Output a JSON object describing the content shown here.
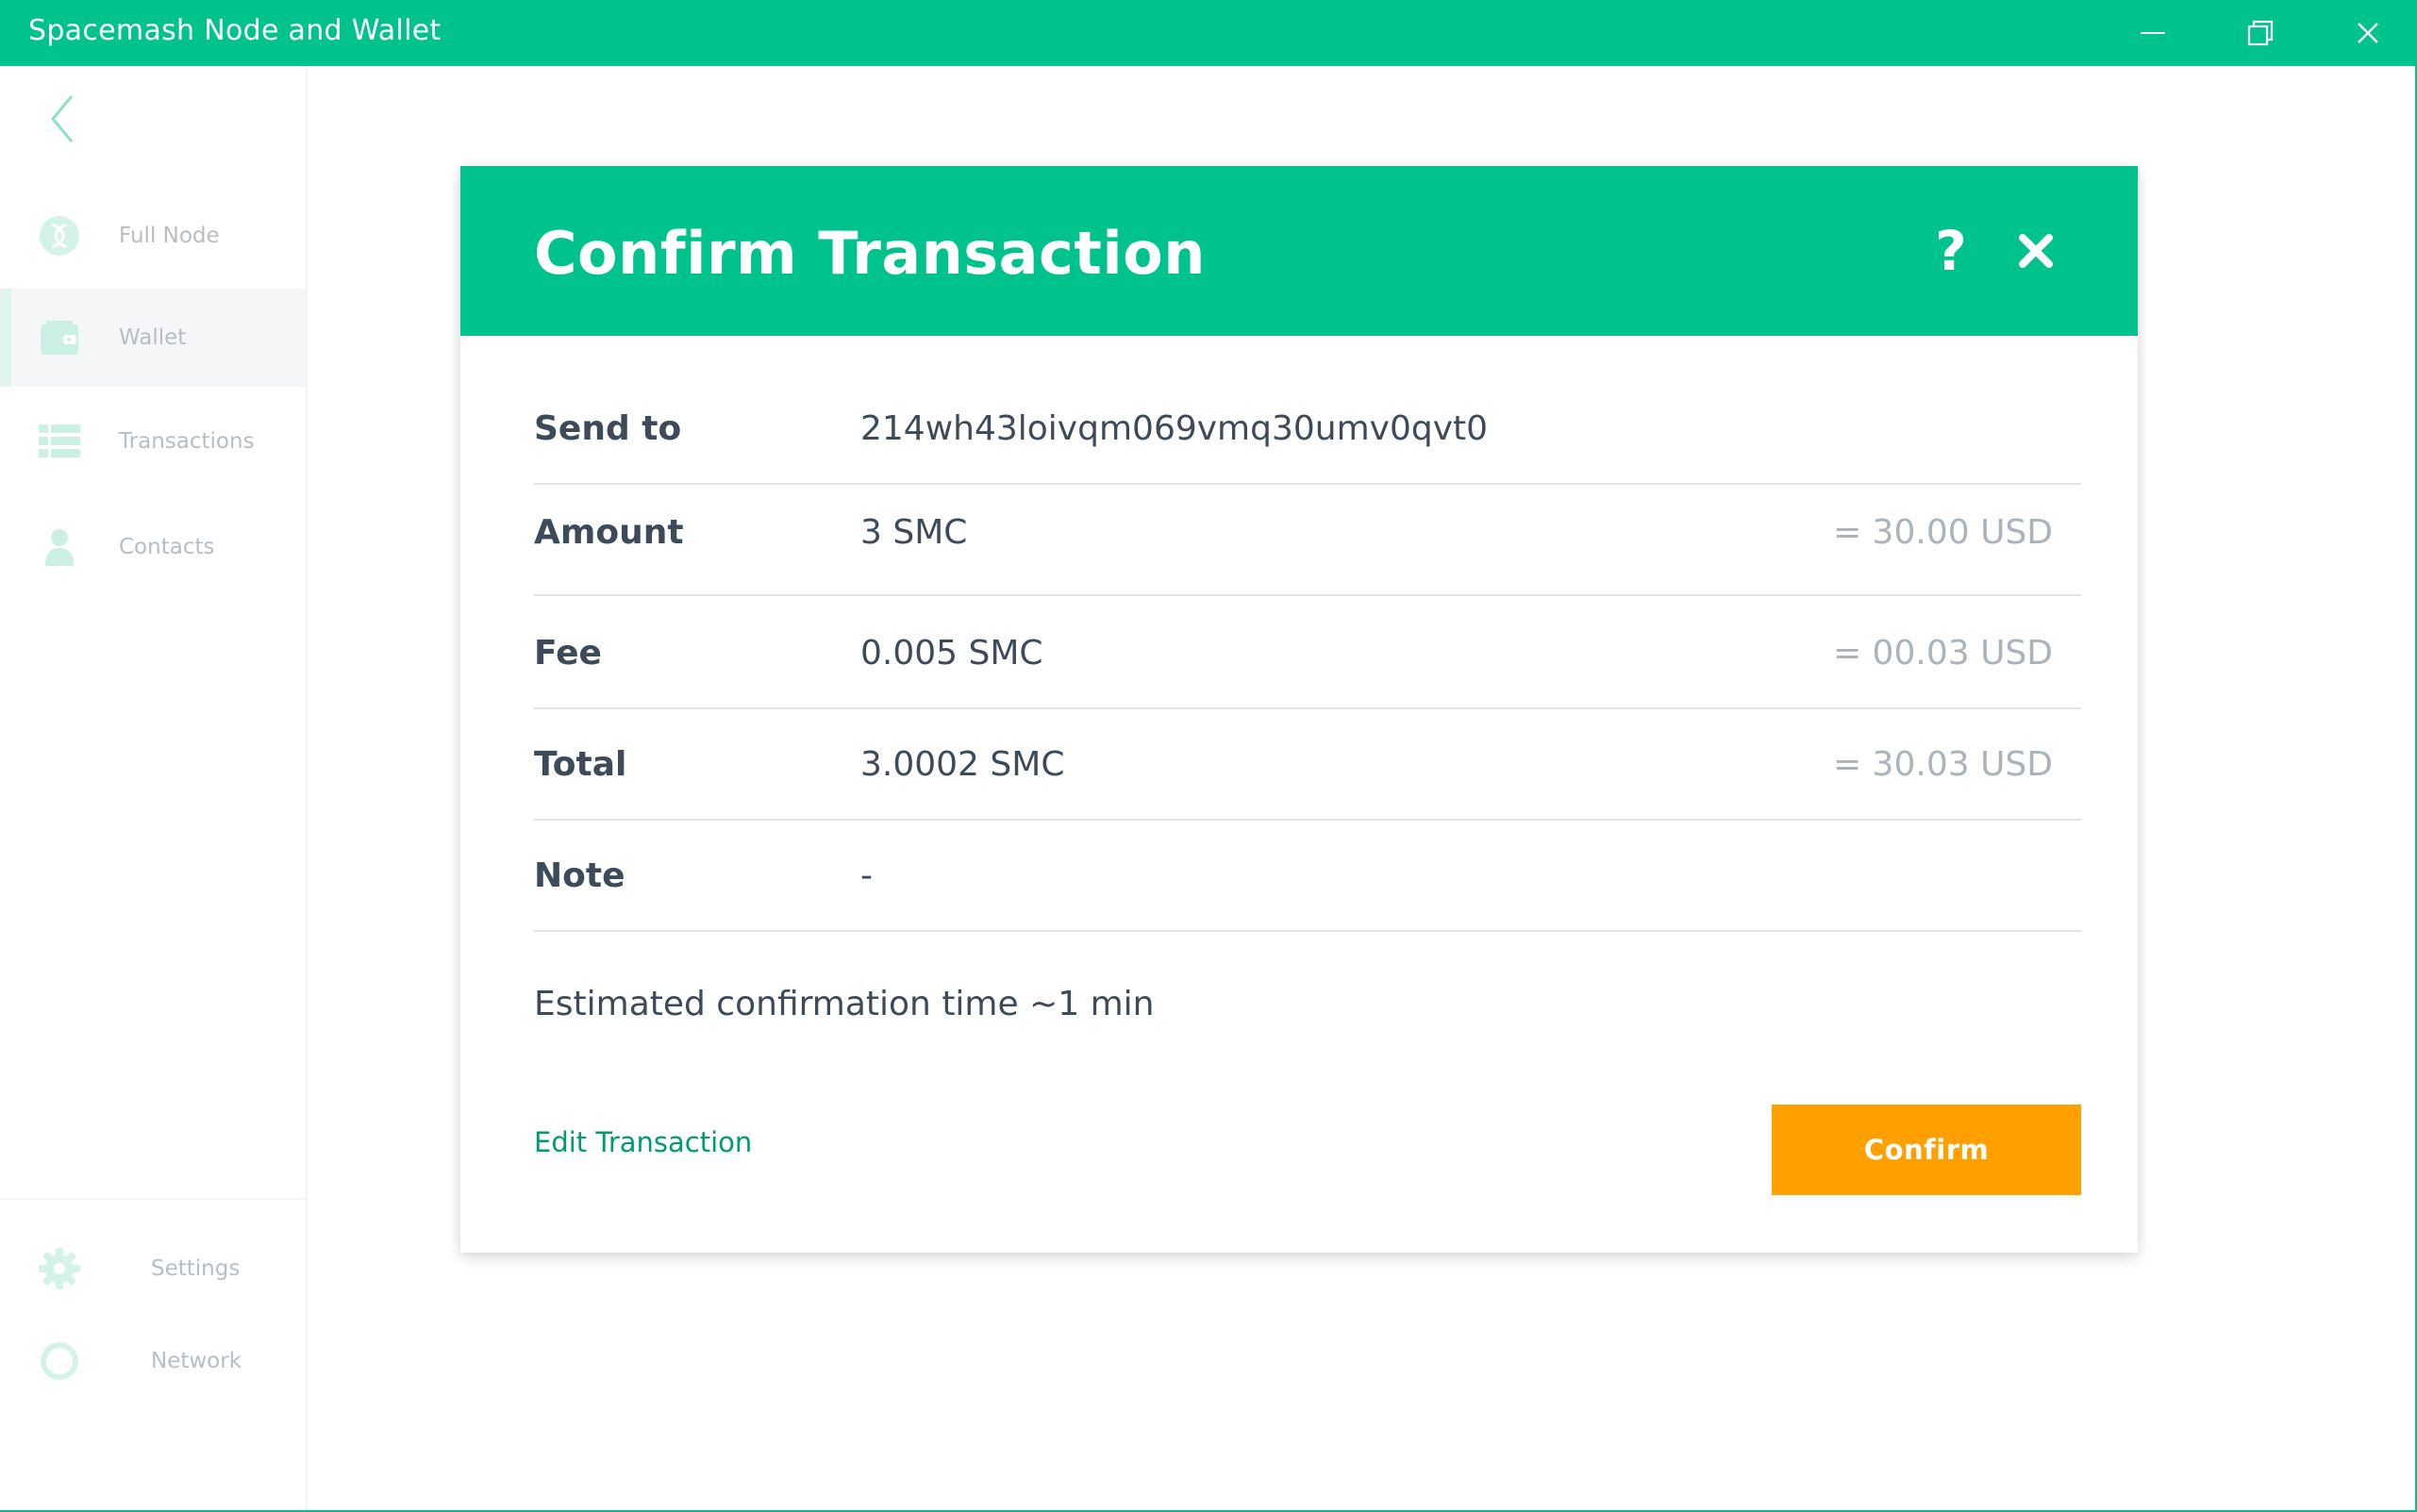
{
  "window": {
    "title": "Spacemash Node and Wallet"
  },
  "sidebar": {
    "items": [
      {
        "label": "Full Node",
        "icon": "full-node-icon"
      },
      {
        "label": "Wallet",
        "icon": "wallet-icon",
        "active": true
      },
      {
        "label": "Transactions",
        "icon": "transactions-icon"
      },
      {
        "label": "Contacts",
        "icon": "contacts-icon"
      }
    ],
    "bottom_items": [
      {
        "label": "Settings",
        "icon": "gear-icon"
      },
      {
        "label": "Network",
        "icon": "network-icon"
      }
    ]
  },
  "modal": {
    "title": "Confirm Transaction",
    "help_label": "?",
    "rows": [
      {
        "key": "Send to",
        "value": "214wh43loivqm069vmq30umv0qvt0",
        "usd": ""
      },
      {
        "key": "Amount",
        "value": "3 SMC",
        "usd": "= 30.00 USD"
      },
      {
        "key": "Fee",
        "value": "0.005 SMC",
        "usd": "= 00.03 USD"
      },
      {
        "key": "Total",
        "value": "3.0002 SMC",
        "usd": "= 30.03 USD"
      },
      {
        "key": "Note",
        "value": "-",
        "usd": ""
      }
    ],
    "estimate": "Estimated confirmation time  ~1 min",
    "edit_label": "Edit Transaction",
    "confirm_label": "Confirm"
  },
  "colors": {
    "brand": "#00c28d",
    "accent": "#ff9f00",
    "text": "#3d4a59",
    "muted": "#aab3ba",
    "link": "#009b71"
  }
}
